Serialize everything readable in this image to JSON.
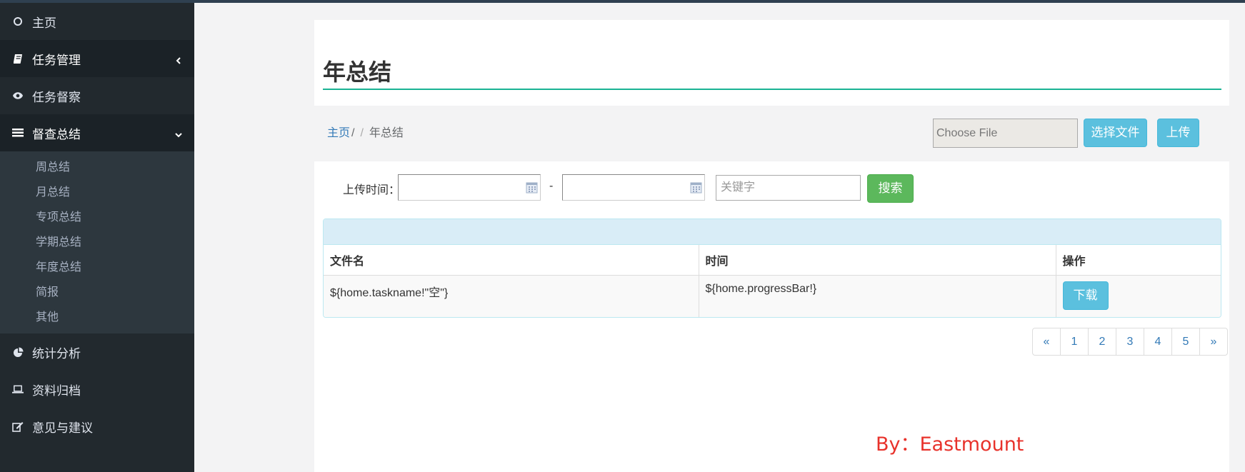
{
  "sidebar": {
    "items": [
      {
        "label": "主页",
        "icon": "circle-icon"
      },
      {
        "label": "任务管理",
        "icon": "book-icon"
      },
      {
        "label": "任务督察",
        "icon": "eye-icon"
      },
      {
        "label": "督查总结",
        "icon": "list-icon"
      },
      {
        "label": "统计分析",
        "icon": "pie-chart-icon"
      },
      {
        "label": "资料归档",
        "icon": "laptop-icon"
      },
      {
        "label": "意见与建议",
        "icon": "edit-icon"
      }
    ],
    "submenu": [
      "周总结",
      "月总结",
      "专项总结",
      "学期总结",
      "年度总结",
      "简报",
      "其他"
    ]
  },
  "page": {
    "title": "年总结"
  },
  "breadcrumb": {
    "home": "主页",
    "sep": "/",
    "current": "年总结"
  },
  "upload": {
    "file_placeholder": "Choose File",
    "choose_label": "选择文件",
    "upload_label": "上传"
  },
  "filter": {
    "time_label": "上传时间：",
    "dash": "-",
    "keyword_placeholder": "关键字",
    "search_label": "搜索"
  },
  "table": {
    "headers": [
      "文件名",
      "时间",
      "操作"
    ],
    "rows": [
      {
        "name": "${home.taskname!\"空\"}",
        "time": "${home.progressBar!}",
        "action": "下载"
      }
    ]
  },
  "pagination": [
    "«",
    "1",
    "2",
    "3",
    "4",
    "5",
    "»"
  ],
  "watermark": "By：Eastmount",
  "colors": {
    "sidebar_bg": "#22292e",
    "accent_line": "#1ab394",
    "info": "#5bc0de",
    "success": "#5cb85c",
    "link": "#337ab7",
    "watermark": "#e8322b"
  }
}
